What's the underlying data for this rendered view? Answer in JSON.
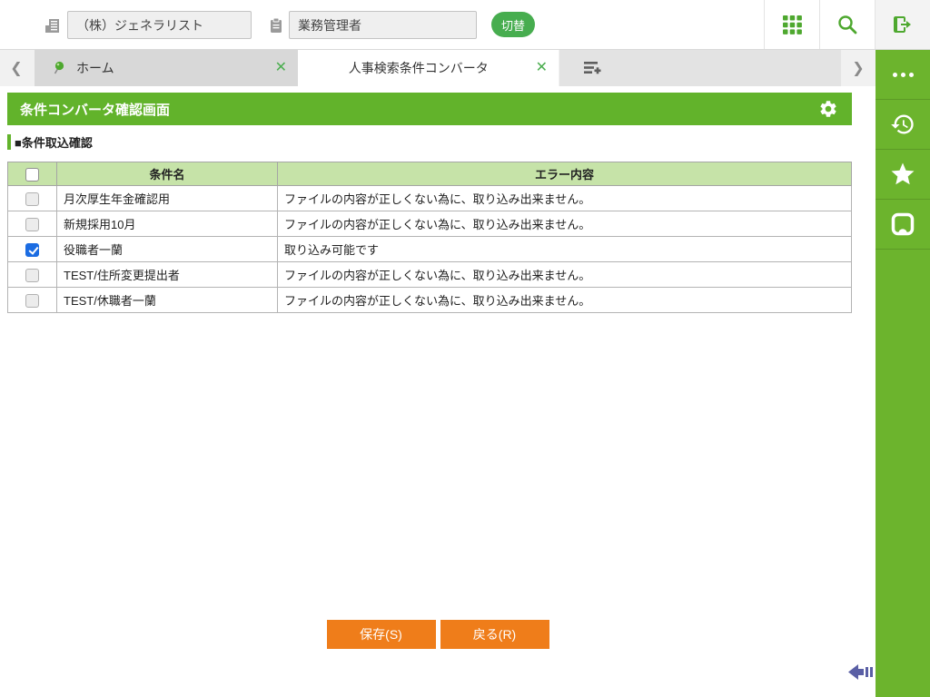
{
  "topbar": {
    "company_value": "（株）ジェネラリスト",
    "role_value": "業務管理者",
    "switch_label": "切替"
  },
  "tabs": [
    {
      "label": "ホーム"
    },
    {
      "label": "人事検索条件コンバータ"
    }
  ],
  "tab_close_glyph": "✕",
  "scroll_left_glyph": "❮",
  "scroll_right_glyph": "❯",
  "page": {
    "title": "条件コンバータ確認画面",
    "section_title": "■条件取込確認"
  },
  "table": {
    "headers": {
      "name": "条件名",
      "error": "エラー内容"
    },
    "rows": [
      {
        "checked": false,
        "name": "月次厚生年金確認用",
        "error": "ファイルの内容が正しくない為に、取り込み出来ません。"
      },
      {
        "checked": false,
        "name": "新規採用10月",
        "error": "ファイルの内容が正しくない為に、取り込み出来ません。"
      },
      {
        "checked": true,
        "name": "役職者一蘭",
        "error": "取り込み可能です"
      },
      {
        "checked": false,
        "name": "TEST/住所変更提出者",
        "error": "ファイルの内容が正しくない為に、取り込み出来ません。"
      },
      {
        "checked": false,
        "name": "TEST/休職者一蘭",
        "error": "ファイルの内容が正しくない為に、取り込み出来ません。"
      }
    ]
  },
  "buttons": {
    "save": "保存(S)",
    "back": "戻る(R)"
  },
  "colors": {
    "sidebar_green": "#6cb42d",
    "header_green": "#62b32b",
    "switch_green": "#47ad4f",
    "table_header_green": "#c6e3a8",
    "action_orange": "#ef7d1a",
    "checkbox_blue": "#1b6ce2",
    "collapse_indigo": "#5a5fa5"
  }
}
